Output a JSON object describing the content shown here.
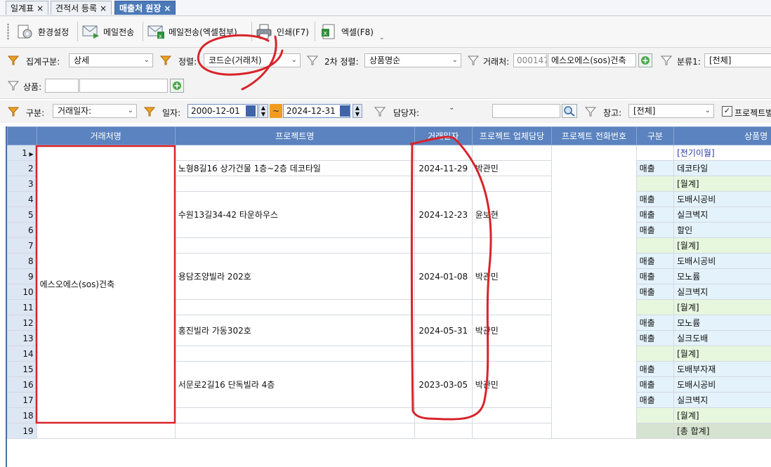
{
  "tabs": [
    {
      "label": "일계표",
      "close": "×"
    },
    {
      "label": "견적서 등록",
      "close": "×"
    },
    {
      "label": "매출처 원장",
      "close": "×"
    }
  ],
  "toolbar": {
    "settings": "환경설정",
    "email": "메일전송",
    "email_excel": "메일전송(엑셀첨부)",
    "print": "인쇄(F7)",
    "excel": "엑셀(F8)"
  },
  "filters": {
    "agg_label": "집계구분:",
    "agg_value": "상세",
    "sort_label": "정렬:",
    "sort_value": "코드순(거래처)",
    "sort2_label": "2차 정렬:",
    "sort2_value": "상품명순",
    "customer_label": "거래처:",
    "customer_code": "000147",
    "customer_name": "에스오에스(sos)건축",
    "class1_label": "분류1:",
    "class1_value": "[전체]",
    "product_label": "상품:",
    "kind_label": "구분:",
    "kind_value": "거래일자:",
    "date_label": "일자:",
    "date_from": "2000-12-01",
    "date_sep": "~",
    "date_to": "2024-12-31",
    "manager_label": "담당자:",
    "warehouse_label": "창고:",
    "warehouse_value": "[전체]",
    "project_check_label": "프로젝트별"
  },
  "grid": {
    "columns": [
      "거래처명",
      "프로젝트명",
      "거래일자",
      "프로젝트 업체담당",
      "프로젝트 전화번호",
      "구분",
      "상품명"
    ],
    "customer_merged": "에스오에스(sos)건축",
    "projects": [
      {
        "name": "노형8길16 상가건물 1층~2층 데코타일",
        "date": "2024-11-29",
        "manager": "박관민"
      },
      {
        "name": "수원13길34-42 타운하우스",
        "date": "2024-12-23",
        "manager": "윤보현"
      },
      {
        "name": "용담조양빌라 202호",
        "date": "2024-01-08",
        "manager": "박관민"
      },
      {
        "name": "홍진빌라 가동302호",
        "date": "2024-05-31",
        "manager": "박관민"
      },
      {
        "name": "서문로2길16 단독빌라 4층",
        "date": "2023-03-05",
        "manager": "박관민"
      }
    ],
    "rows": [
      {
        "n": "1",
        "kind": "",
        "item": "[전기이월]"
      },
      {
        "n": "2",
        "kind": "매출",
        "item": "데코타일"
      },
      {
        "n": "3",
        "kind": "",
        "item": "[월계]"
      },
      {
        "n": "4",
        "kind": "매출",
        "item": "도배시공비"
      },
      {
        "n": "5",
        "kind": "매출",
        "item": "실크벽지"
      },
      {
        "n": "6",
        "kind": "매출",
        "item": "할인"
      },
      {
        "n": "7",
        "kind": "",
        "item": "[월계]"
      },
      {
        "n": "8",
        "kind": "매출",
        "item": "도배시공비"
      },
      {
        "n": "9",
        "kind": "매출",
        "item": "모노륨"
      },
      {
        "n": "10",
        "kind": "매출",
        "item": "실크벽지"
      },
      {
        "n": "11",
        "kind": "",
        "item": "[월계]"
      },
      {
        "n": "12",
        "kind": "매출",
        "item": "모노륨"
      },
      {
        "n": "13",
        "kind": "매출",
        "item": "실크도배"
      },
      {
        "n": "14",
        "kind": "",
        "item": "[월계]"
      },
      {
        "n": "15",
        "kind": "매출",
        "item": "도배부자재"
      },
      {
        "n": "16",
        "kind": "매출",
        "item": "도배시공비"
      },
      {
        "n": "17",
        "kind": "매출",
        "item": "실크벽지"
      },
      {
        "n": "18",
        "kind": "",
        "item": "[월계]"
      },
      {
        "n": "19",
        "kind": "",
        "item": "[총 합계]"
      }
    ]
  },
  "colors": {
    "header_blue": "#5b83bf",
    "tab_active": "#4b79b8",
    "annotation_red": "#d8232a",
    "subtotal_green": "#e6f7de",
    "sale_blue": "#e3f2fb"
  }
}
